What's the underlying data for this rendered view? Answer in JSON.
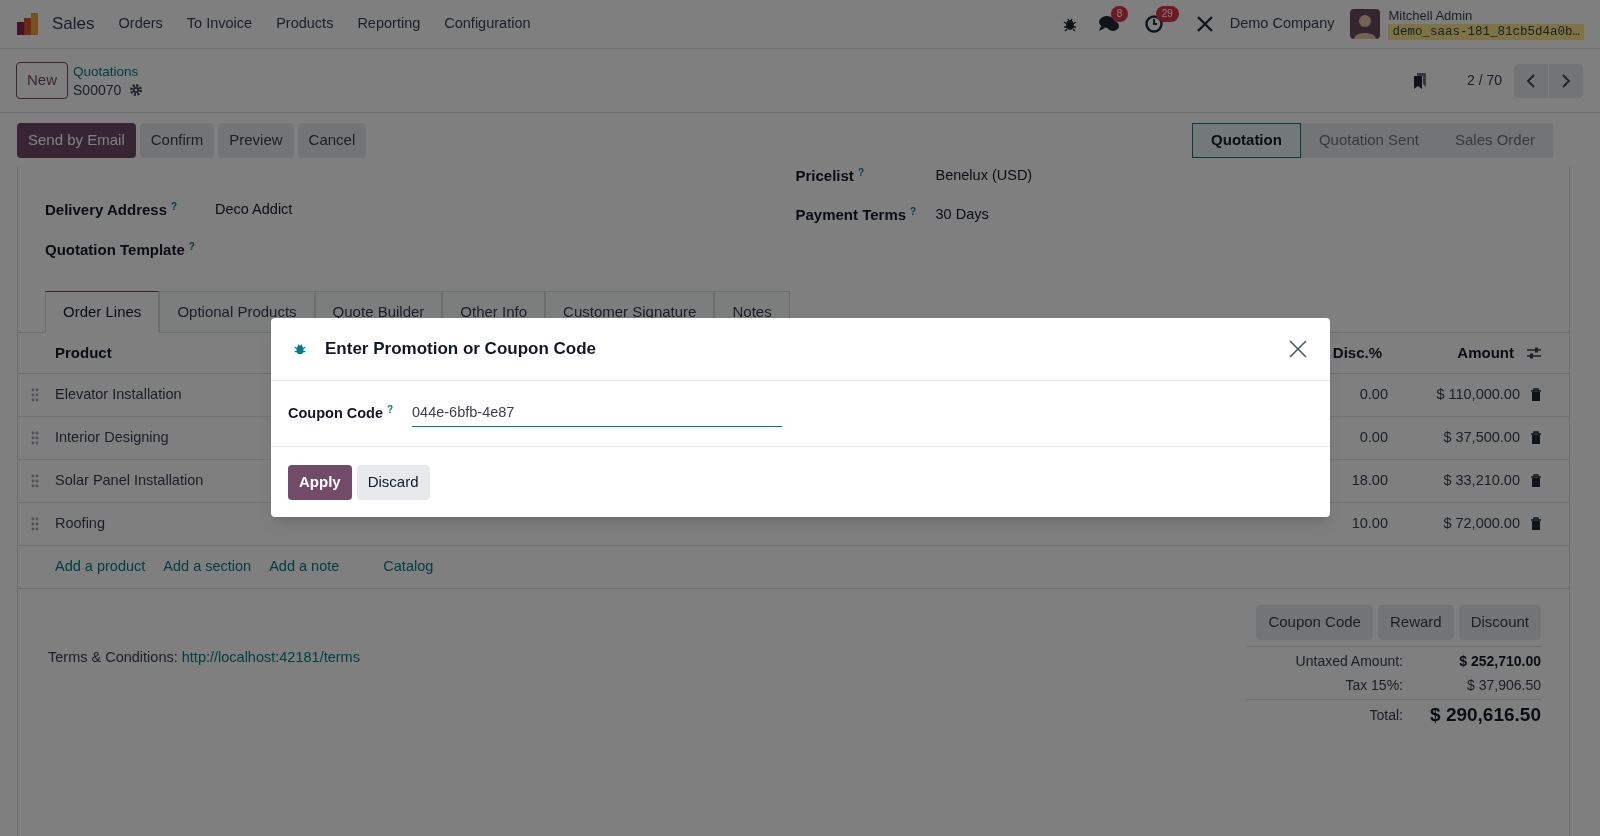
{
  "navbar": {
    "app": "Sales",
    "menu": [
      "Orders",
      "To Invoice",
      "Products",
      "Reporting",
      "Configuration"
    ],
    "messages_count": "8",
    "activities_count": "29",
    "company": "Demo Company",
    "user": {
      "name": "Mitchell Admin",
      "database": "demo_saas-181_81cb5d4a0b…"
    }
  },
  "control_panel": {
    "new_button": "New",
    "breadcrumb": "Quotations",
    "record": "S00070",
    "pager": "2 / 70"
  },
  "actions": [
    {
      "label": "Send by Email",
      "primary": true
    },
    {
      "label": "Confirm",
      "primary": false
    },
    {
      "label": "Preview",
      "primary": false
    },
    {
      "label": "Cancel",
      "primary": false
    }
  ],
  "statusbar": [
    {
      "label": "Quotation",
      "selected": true
    },
    {
      "label": "Quotation Sent",
      "selected": false
    },
    {
      "label": "Sales Order",
      "selected": false
    }
  ],
  "fields_left": [
    {
      "label": "Delivery Address",
      "help": "?",
      "value": "Deco Addict"
    },
    {
      "label": "Quotation Template",
      "help": "?"
    }
  ],
  "fields_right": [
    {
      "label": "Pricelist",
      "help": "?",
      "value": "Benelux (USD)"
    },
    {
      "label": "Payment Terms",
      "help": "?",
      "value": "30 Days"
    }
  ],
  "tabs": [
    {
      "label": "Order Lines",
      "selected": true
    },
    {
      "label": "Optional Products",
      "selected": false
    },
    {
      "label": "Quote Builder",
      "selected": false
    },
    {
      "label": "Other Info",
      "selected": false
    },
    {
      "label": "Customer Signature",
      "selected": false
    },
    {
      "label": "Notes",
      "selected": false
    }
  ],
  "table": {
    "columns": [
      "Product",
      "Disc.%",
      "Amount"
    ],
    "rows": [
      {
        "product": "Elevator Installation",
        "disc": "0.00",
        "amount": "$ 110,000.00"
      },
      {
        "product": "Interior Designing",
        "disc": "0.00",
        "amount": "$ 37,500.00"
      },
      {
        "product": "Solar Panel Installation",
        "disc": "18.00",
        "amount": "$ 33,210.00"
      },
      {
        "product": "Roofing",
        "disc": "10.00",
        "amount": "$ 72,000.00"
      }
    ],
    "add_links": [
      "Add a product",
      "Add a section",
      "Add a note",
      "Catalog"
    ]
  },
  "footer": {
    "buttons": [
      "Coupon Code",
      "Reward",
      "Discount"
    ],
    "terms_label": "Terms & Conditions:",
    "terms_link": "http://localhost:42181/terms",
    "totals": [
      {
        "label": "Untaxed Amount:",
        "value": "$ 252,710.00",
        "kind": "subtotal"
      },
      {
        "label": "Tax 15%:",
        "value": "$ 37,906.50",
        "kind": "tax"
      },
      {
        "label": "Total:",
        "value": "$ 290,616.50",
        "kind": "total"
      }
    ]
  },
  "dialog": {
    "title": "Enter Promotion or Coupon Code",
    "field_label": "Coupon Code",
    "field_help": "?",
    "value": "044e-6bfb-4e87",
    "buttons": [
      {
        "label": "Apply",
        "primary": true
      },
      {
        "label": "Discard",
        "primary": false
      }
    ]
  }
}
